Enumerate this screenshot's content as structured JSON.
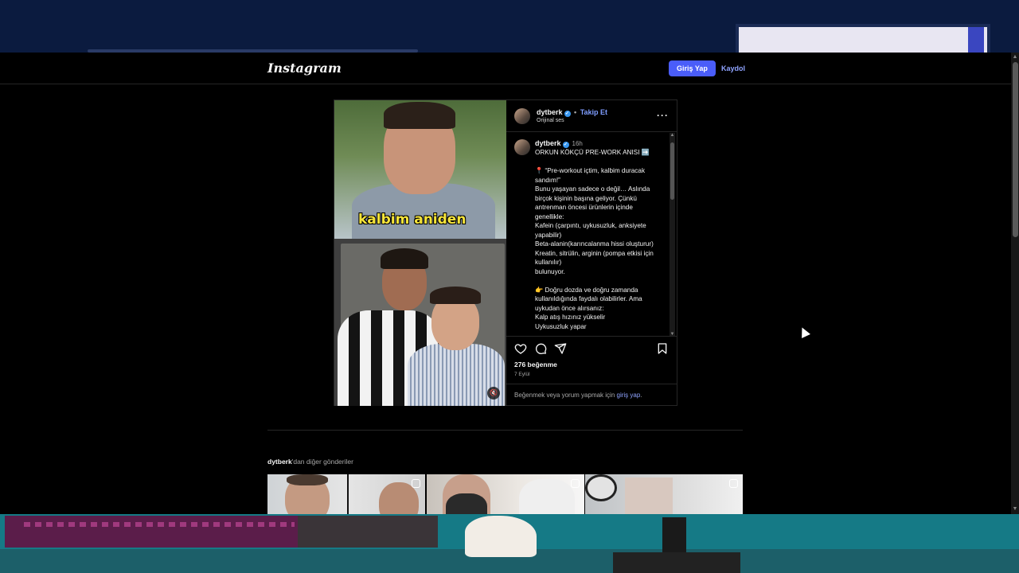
{
  "app": {
    "logo": "Instagram",
    "login_button": "Giriş Yap",
    "signup_link": "Kaydol"
  },
  "post": {
    "author": {
      "username": "dytberk",
      "verified_icon": "verified-badge-icon",
      "separator": "•",
      "follow_label": "Takip Et",
      "audio": "Orijinal ses"
    },
    "more_icon": "ellipsis-icon",
    "more_glyph": "···",
    "media": {
      "overlay_text": "kalbim aniden",
      "mute_icon": "speaker-muted-icon",
      "mute_glyph": "🔇"
    },
    "caption": {
      "username": "dytberk",
      "time": "16h",
      "text": "ORKUN KÖKÇÜ PRE-WORK ANISI ➡️\n\n📍 “Pre-workout içtim, kalbim duracak sandım!”\nBunu yaşayan sadece o değil… Aslında birçok kişinin başına geliyor. Çünkü antrenman öncesi ürünlerin içinde genellikle:\nKafein (çarpıntı, uykusuzluk, anksiyete yapabilir)\nBeta-alanin(karıncalanma hissi oluşturur)\nKreatin, sitrülin, arginin (pompa etkisi için kullanılır)\nbulunuyor.\n\n👉 Doğru dozda ve doğru zamanda kullanıldığında faydalı olabilirler. Ama uykudan önce alırsanız:\nKalp atış hızınız yükselir\nUykusuzluk yapar"
    },
    "actions": {
      "like_icon": "heart-icon",
      "comment_icon": "comment-icon",
      "share_icon": "send-icon",
      "save_icon": "bookmark-icon"
    },
    "likes": "276 beğenme",
    "date": "7 Eylül",
    "login_prompt": {
      "text": "Beğenmek veya yorum yapmak için",
      "link": "giriş yap",
      "end": "."
    }
  },
  "more_posts": {
    "username": "dytberk",
    "suffix": "'dan diğer gönderiler",
    "thumbnails": [
      {
        "label": "reel-thumbnail-1",
        "reel_icon": "reels-icon"
      },
      {
        "label": "reel-thumbnail-2",
        "reel_icon": "reels-icon"
      },
      {
        "label": "reel-thumbnail-3",
        "reel_icon": "reels-icon"
      }
    ]
  },
  "colors": {
    "accent": "#4a5df9",
    "link": "#8fa3ff",
    "background": "#000000",
    "overlay_text": "#f7e53a"
  }
}
